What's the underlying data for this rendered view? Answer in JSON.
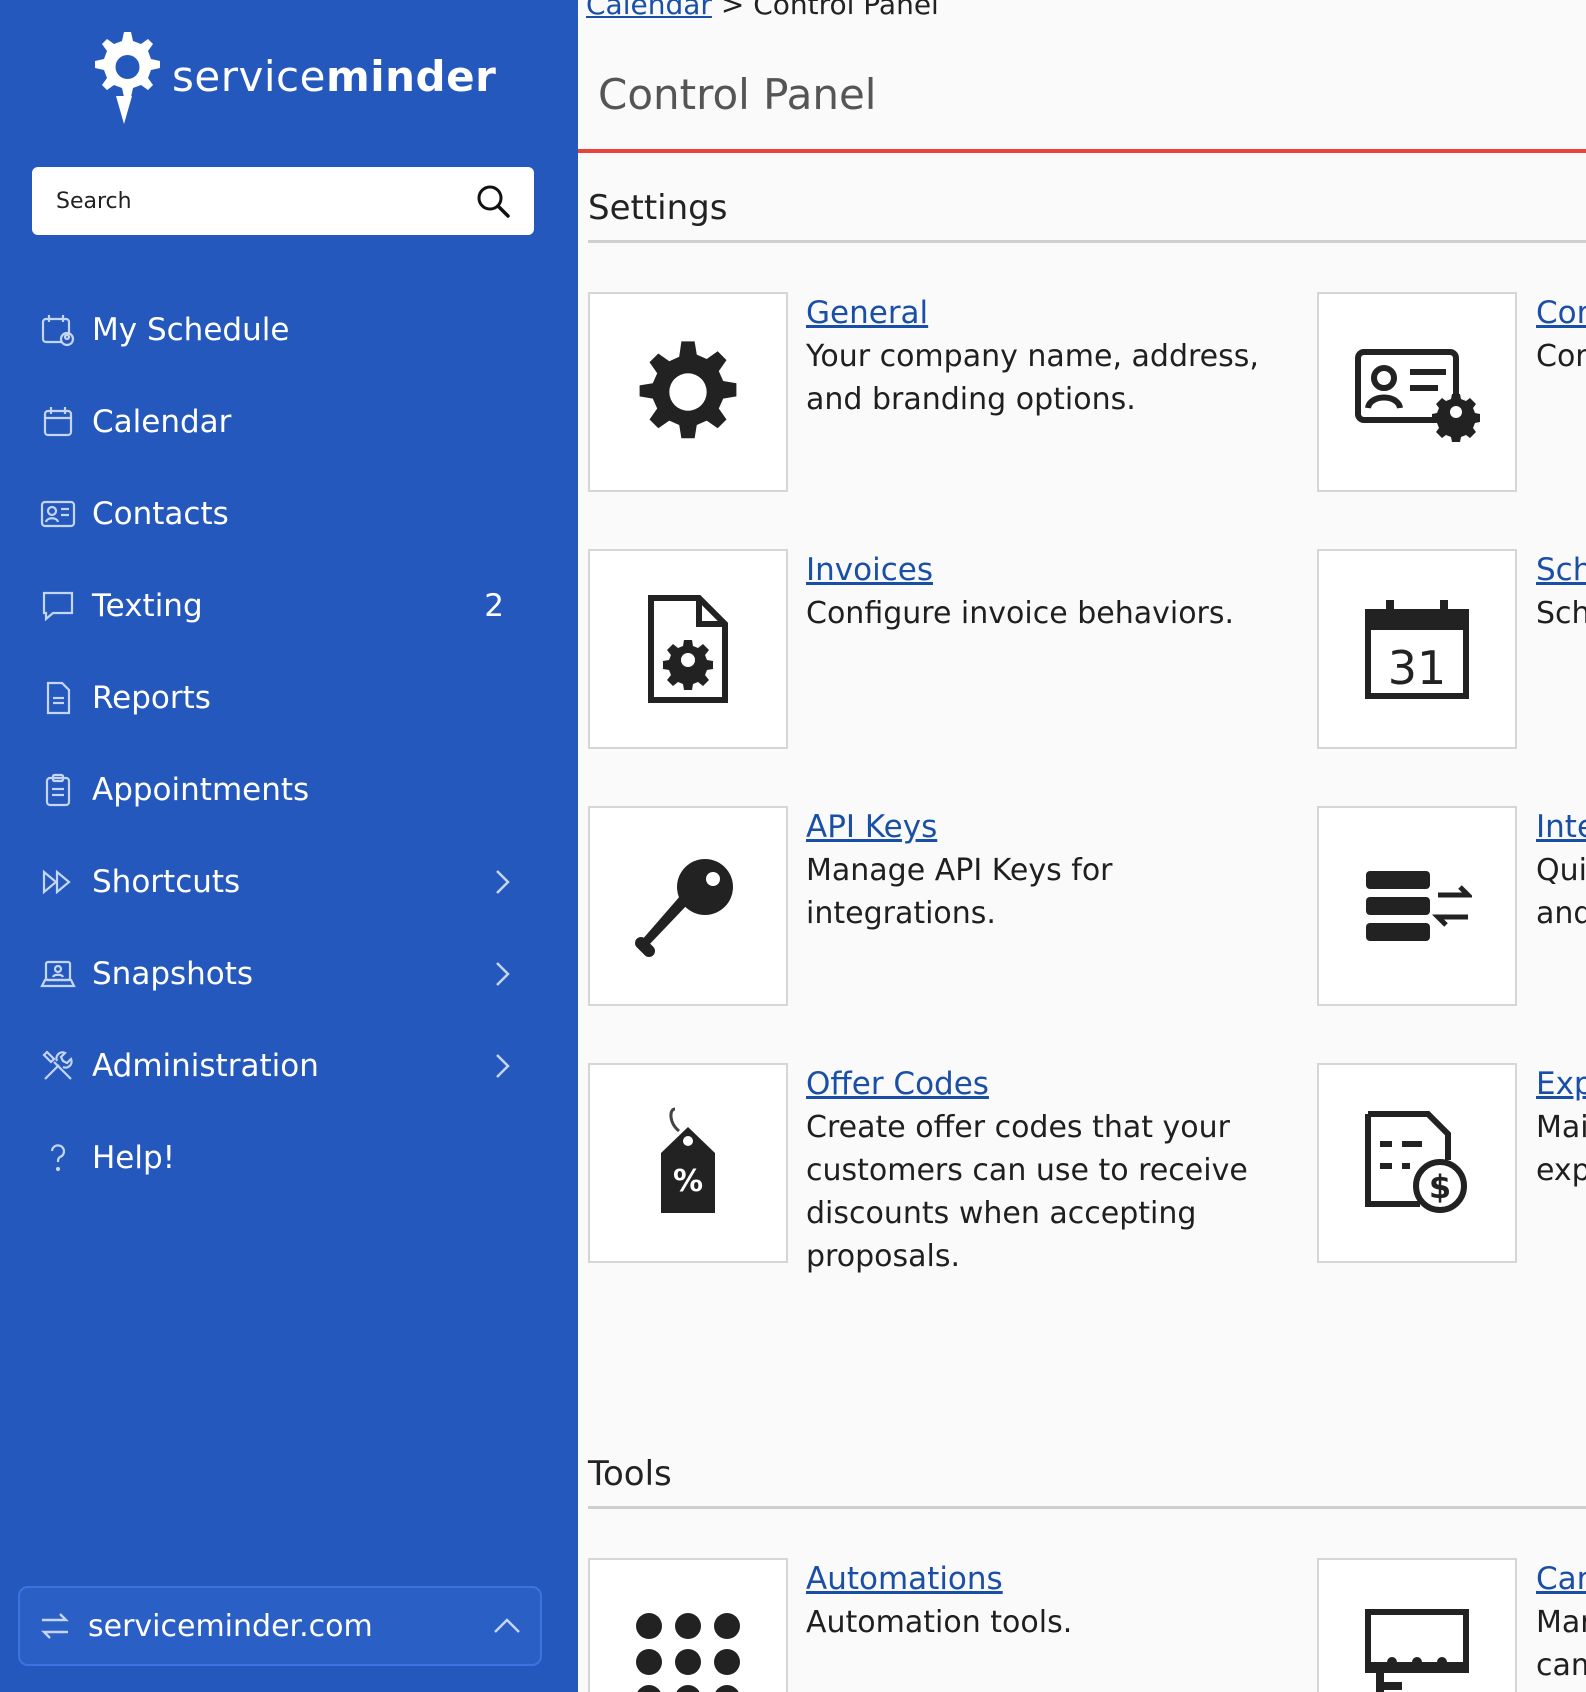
{
  "brand": {
    "name_light": "service",
    "name_bold": "minder"
  },
  "search": {
    "placeholder": "Search"
  },
  "nav": [
    {
      "label": "My Schedule",
      "icon": "calendar-user-icon"
    },
    {
      "label": "Calendar",
      "icon": "calendar-icon"
    },
    {
      "label": "Contacts",
      "icon": "contact-card-icon"
    },
    {
      "label": "Texting",
      "icon": "chat-bubble-icon",
      "badge": "2"
    },
    {
      "label": "Reports",
      "icon": "report-document-icon"
    },
    {
      "label": "Appointments",
      "icon": "clipboard-icon"
    },
    {
      "label": "Shortcuts",
      "icon": "fast-forward-icon"
    },
    {
      "label": "Snapshots",
      "icon": "laptop-user-icon"
    },
    {
      "label": "Administration",
      "icon": "tools-icon"
    },
    {
      "label": "Help!",
      "icon": "question-icon"
    }
  ],
  "footer": {
    "label": "serviceminder.com"
  },
  "breadcrumb": {
    "link": "Calendar",
    "separator": ">",
    "current": "Control Panel"
  },
  "page_title": "Control Panel",
  "sections": {
    "settings": "Settings",
    "tools": "Tools"
  },
  "settings_left": [
    {
      "title": "General",
      "desc": "Your company name, address, and branding options."
    },
    {
      "title": "Invoices",
      "desc": "Configure invoice behaviors."
    },
    {
      "title": "API Keys",
      "desc": "Manage API Keys for integrations."
    },
    {
      "title": "Offer Codes",
      "desc": "Create offer codes that your customers can use to receive discounts when accepting proposals."
    }
  ],
  "settings_right": [
    {
      "title": "Cor",
      "desc": "Cor"
    },
    {
      "title": "Sch",
      "desc": "Sch"
    },
    {
      "title": "Inte",
      "desc": "Qui and"
    },
    {
      "title": "Exp",
      "desc": "Mai exp"
    }
  ],
  "tools_left": [
    {
      "title": "Automations",
      "desc": "Automation tools."
    }
  ],
  "tools_right": [
    {
      "title": "Car",
      "desc": "Mar cam"
    }
  ],
  "colors": {
    "sidebar": "#2558bd",
    "accent_rule": "#e8433a",
    "link": "#1a4fa8"
  }
}
